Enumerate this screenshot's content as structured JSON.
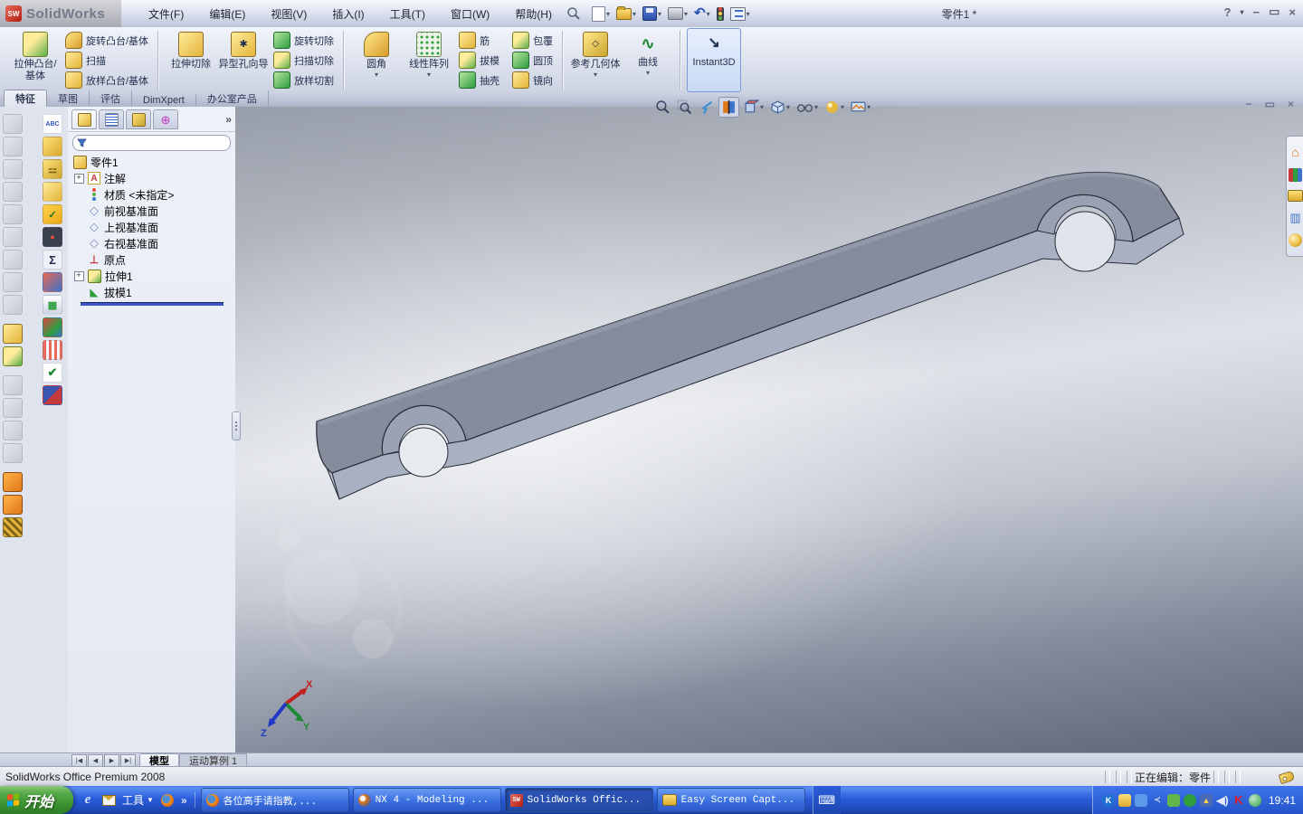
{
  "titlebar": {
    "app_name": "SolidWorks",
    "document_title": "零件1 *",
    "menus": [
      "文件(F)",
      "编辑(E)",
      "视图(V)",
      "插入(I)",
      "工具(T)",
      "窗口(W)",
      "帮助(H)"
    ],
    "quick_icons": [
      "search-icon",
      "new-document-icon",
      "open-icon",
      "save-icon",
      "print-icon",
      "undo-icon",
      "rebuild-traffic-light-icon",
      "options-icon"
    ],
    "help_label": "?",
    "window_buttons": {
      "minimize": "−",
      "restore": "▭",
      "close": "×"
    }
  },
  "ribbon": {
    "extrude_boss": "拉伸凸台/基体",
    "revolve_boss": "旋转凸台/基体",
    "sweep": "扫描",
    "loft_boss": "放样凸台/基体",
    "extrude_cut": "拉伸切除",
    "hole_wizard": "异型孔向导",
    "revolve_cut": "旋转切除",
    "sweep_cut": "扫描切除",
    "loft_cut": "放样切割",
    "fillet": "圆角",
    "linear_pattern": "线性阵列",
    "rib": "筋",
    "draft": "拔模",
    "shell": "抽壳",
    "wrap": "包覆",
    "dome": "圆顶",
    "mirror": "镜向",
    "reference_geometry": "参考几何体",
    "curves": "曲线",
    "instant3d": "Instant3D"
  },
  "manager_tabs": [
    "特征",
    "草图",
    "评估",
    "DimXpert",
    "办公室产品"
  ],
  "feature_panel": {
    "panel_tab_icons": [
      "featuremanager-tab",
      "propertymanager-tab",
      "configurationmanager-tab",
      "dimxpertmanager-tab"
    ],
    "expand_label": "»",
    "tree": {
      "root": "零件1",
      "items": [
        "注解",
        "材质 <未指定>",
        "前视基准面",
        "上视基准面",
        "右视基准面",
        "原点",
        "拉伸1",
        "拔模1"
      ]
    }
  },
  "left_toolbars": {
    "features_column": [
      "instant3d",
      "dome",
      "freeform",
      "shape",
      "sweep",
      "flex",
      "spline",
      "indent",
      "cavity",
      "join",
      "extrude-boss",
      "extrude-cut",
      "hole-simple",
      "mirror",
      "pattern",
      "fillet",
      "wrap",
      "rib",
      "checker"
    ],
    "tools_column": [
      "spell-checker",
      "measure",
      "mass-properties",
      "statistics",
      "check",
      "rebuild-clock",
      "equations",
      "curvature",
      "deviation-analysis",
      "analysis",
      "zebra-stripes",
      "geometry-check",
      "edit-color"
    ]
  },
  "viewport": {
    "hud_icons": [
      "zoom-to-fit",
      "zoom-to-area",
      "previous-view",
      "section-view",
      "view-orientation",
      "display-style",
      "hide-show-items",
      "edit-appearance",
      "apply-scene"
    ],
    "triad": {
      "x": "X",
      "y": "Y",
      "z": "Z"
    }
  },
  "task_pane_icons": [
    "solidworks-resources",
    "design-library",
    "file-explorer",
    "view-palette",
    "appearances"
  ],
  "bottom_tabs": {
    "model": "模型",
    "motion_study": "运动算例 1"
  },
  "status_bar": {
    "left": "SolidWorks Office Premium 2008",
    "editing": "正在编辑：零件"
  },
  "taskbar": {
    "start": "开始",
    "quick_launch_tools": "工具",
    "quick_launch_icons": [
      "ie-icon",
      "mail-icon",
      "tools-menu",
      "firefox-icon",
      "more-chevron"
    ],
    "windows": [
      {
        "title": "各位高手请指教,...",
        "icon": "firefox"
      },
      {
        "title": "NX 4 - Modeling ...",
        "icon": "nx"
      },
      {
        "title": "SolidWorks Offic...",
        "icon": "solidworks"
      },
      {
        "title": "Easy Screen Capt...",
        "icon": "folder"
      }
    ],
    "tray_icons": [
      "kingsoft",
      "folder-share",
      "network",
      "cable",
      "display",
      "shield-plus",
      "network-warning",
      "volume",
      "kaspersky",
      "globe"
    ],
    "clock": "19:41"
  }
}
